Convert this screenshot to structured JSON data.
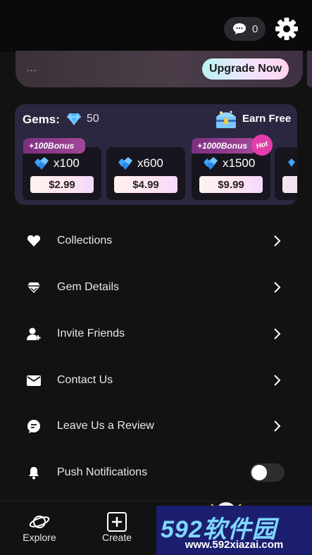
{
  "header": {
    "message_count": "0"
  },
  "banner": {
    "text": "...",
    "upgrade_label": "Upgrade Now"
  },
  "gems": {
    "label": "Gems:",
    "count": "50",
    "earn_label": "Earn Free",
    "packs": [
      {
        "bonus": "+100Bonus",
        "quantity": "x100",
        "price": "$2.99"
      },
      {
        "bonus": "",
        "quantity": "x600",
        "price": "$4.99"
      },
      {
        "bonus": "+1000Bonus",
        "hot": "Hot",
        "quantity": "x1500",
        "price": "$9.99"
      }
    ]
  },
  "menu": {
    "items": [
      {
        "label": "Collections",
        "icon": "heart-icon"
      },
      {
        "label": "Gem Details",
        "icon": "diamond-icon"
      },
      {
        "label": "Invite Friends",
        "icon": "add-user-icon"
      },
      {
        "label": "Contact Us",
        "icon": "envelope-icon"
      },
      {
        "label": "Leave Us a Review",
        "icon": "review-icon"
      },
      {
        "label": "Push Notifications",
        "icon": "bell-icon",
        "toggle_on": false
      }
    ]
  },
  "nav": {
    "explore_label": "Explore",
    "create_label": "Create"
  },
  "watermark": {
    "title": "592软件园",
    "url": "www.592xiazai.com"
  },
  "colors": {
    "background": "#121212",
    "card": "#2b2740",
    "accent_pink": "#e23da8",
    "gem_blue": "#4db8ff"
  }
}
